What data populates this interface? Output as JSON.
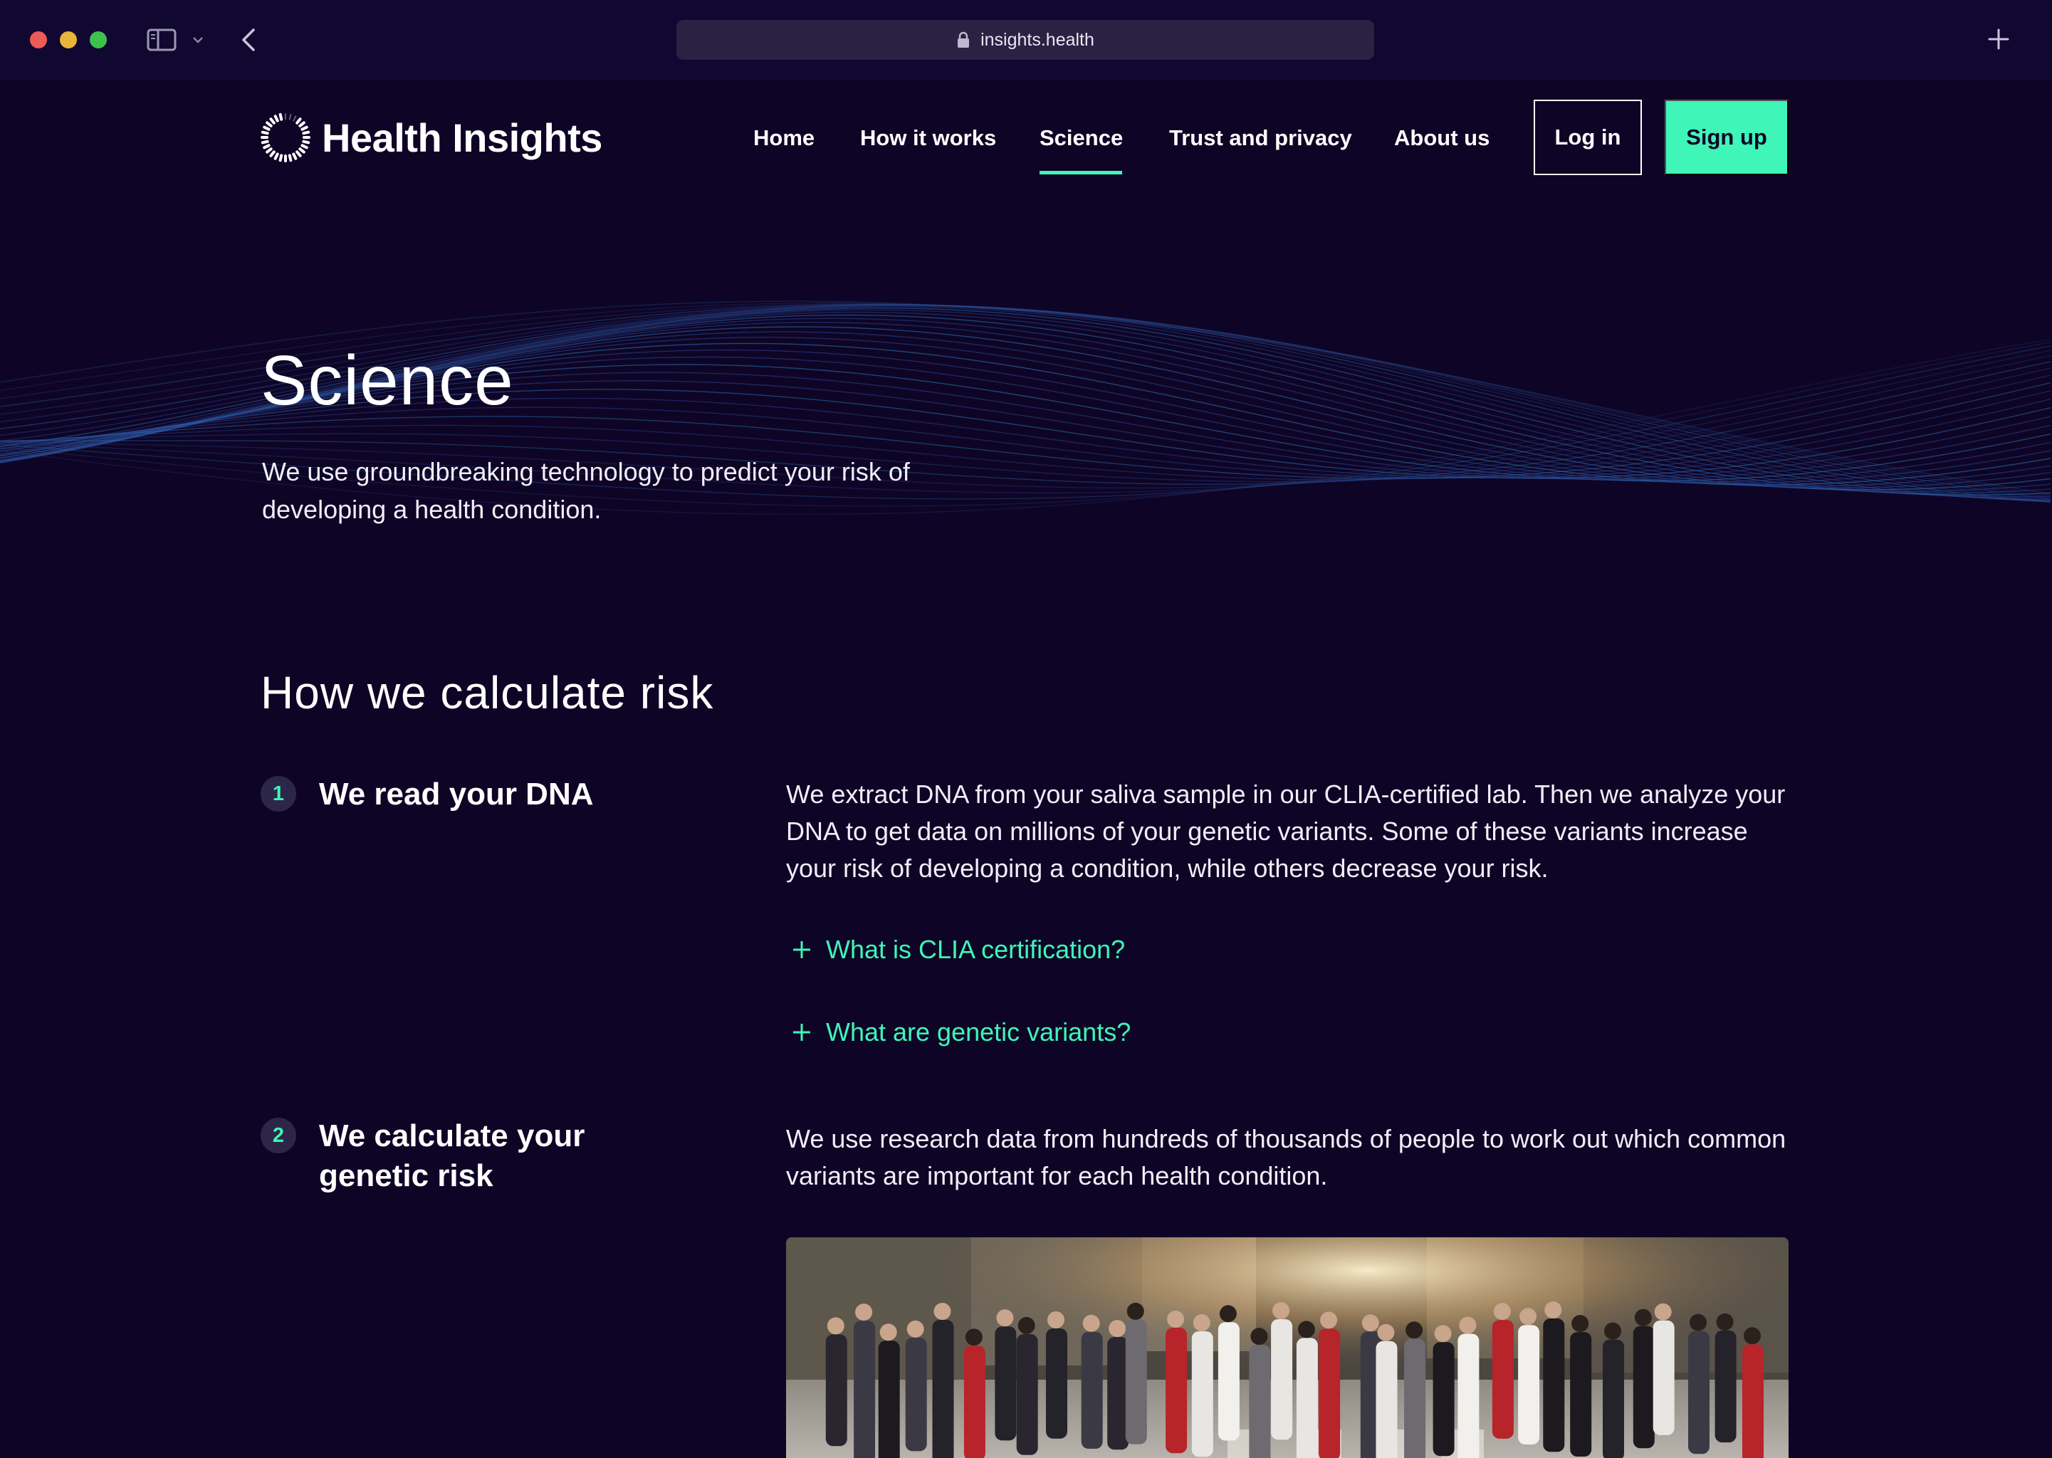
{
  "browser": {
    "url": "insights.health"
  },
  "site": {
    "brand": "Health Insights",
    "nav": {
      "home": "Home",
      "how_it_works": "How it works",
      "science": "Science",
      "trust_privacy": "Trust and privacy",
      "about": "About us"
    },
    "active_nav": "Science",
    "login_label": "Log in",
    "signup_label": "Sign up",
    "accent_color": "#3ff5b8",
    "background_color": "#0e0526"
  },
  "hero": {
    "title": "Science",
    "subtitle": "We use groundbreaking technology to predict your risk of developing a health condition."
  },
  "section": {
    "title": "How we calculate risk",
    "steps": [
      {
        "number": "1",
        "title": "We read your DNA",
        "body": "We extract DNA from your saliva sample in our CLIA-certified lab. Then we analyze your DNA to get data on millions of your genetic variants. Some of these variants increase your risk of developing a condition, while others decrease your risk.",
        "faqs": [
          "What is CLIA certification?",
          "What are genetic variants?"
        ]
      },
      {
        "number": "2",
        "title": "We calculate your genetic risk",
        "body": "We use research data from hundreds of thousands of people to work out which common variants are important for each health condition."
      }
    ]
  }
}
